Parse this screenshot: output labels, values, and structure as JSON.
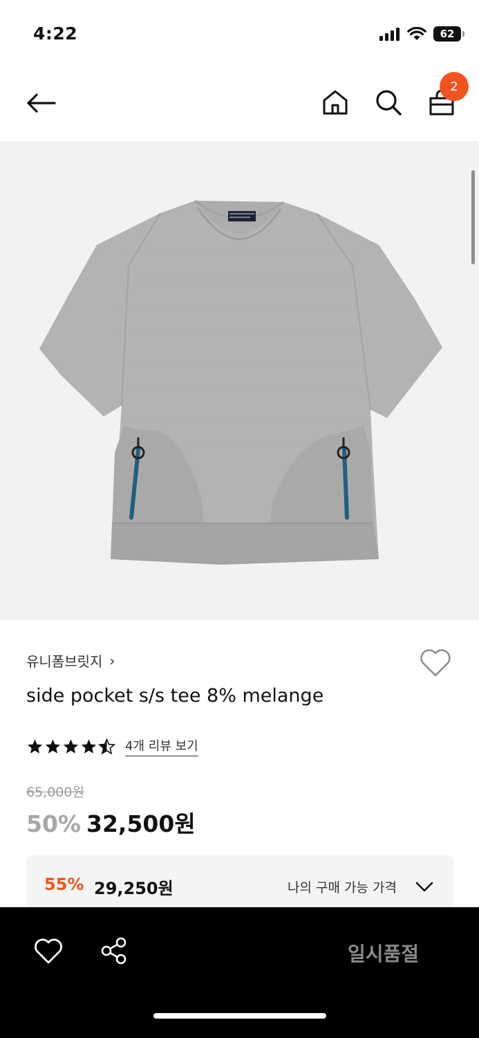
{
  "status": {
    "time": "4:22",
    "battery": "62"
  },
  "nav": {
    "cart_count": "2"
  },
  "product": {
    "brand": "유니폼브릿지",
    "brand_chevron": "›",
    "name": "side pocket s/s tee 8% melange",
    "rating": 4.5,
    "review_link": "4개 리뷰 보기",
    "original_price": "65,000원",
    "discount_rate": "50%",
    "sale_price": "32,500원",
    "member_rate": "55%",
    "member_price": "29,250원",
    "member_label": "나의 구매 가능 가격"
  },
  "bottom_bar": {
    "soldout_label": "일시품절"
  },
  "colors": {
    "accent": "#f3541f",
    "image_bg": "#f2f2f2",
    "shirt": "#b3b3b3",
    "panel": "#a9aaa7",
    "zipper": "#1f5e86"
  },
  "icons": [
    "back-arrow-icon",
    "home-icon",
    "search-icon",
    "shopping-bag-icon",
    "heart-icon",
    "chevron-right-icon",
    "star-icon",
    "chevron-down-icon",
    "share-icon"
  ]
}
